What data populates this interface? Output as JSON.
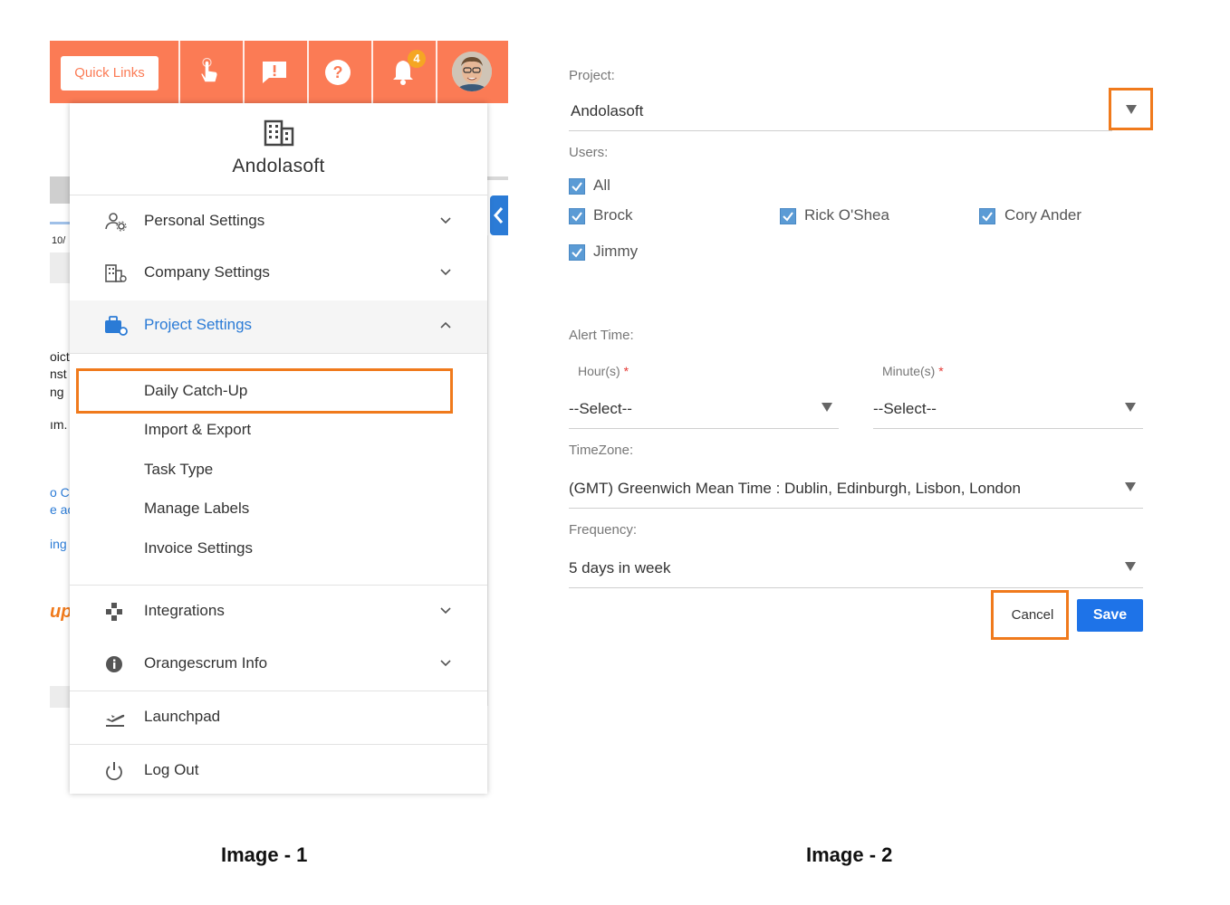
{
  "image1": {
    "topbar": {
      "quick_links_label": "Quick Links",
      "notification_count": "4",
      "icons": [
        "hand-pointer-icon",
        "feedback-icon",
        "help-icon",
        "bell-icon",
        "user-avatar"
      ]
    },
    "background_fragments": [
      "10/",
      "oict",
      "nst",
      "ng",
      "ım.",
      "o C",
      "e ac",
      "ing",
      "up"
    ],
    "menu": {
      "company_name": "Andolasoft",
      "items": [
        {
          "label": "Personal Settings",
          "icon": "user-gear-icon"
        },
        {
          "label": "Company Settings",
          "icon": "building-gear-icon"
        },
        {
          "label": "Project Settings",
          "icon": "briefcase-gear-icon",
          "expanded": true
        }
      ],
      "project_sub_items": [
        "Daily Catch-Up",
        "Import & Export",
        "Task Type",
        "Manage Labels",
        "Invoice Settings"
      ],
      "lower_items": [
        {
          "label": "Integrations",
          "icon": "puzzle-icon"
        },
        {
          "label": "Orangescrum Info",
          "icon": "info-icon"
        },
        {
          "label": "Launchpad",
          "icon": "plane-takeoff-icon"
        },
        {
          "label": "Log Out",
          "icon": "power-icon"
        }
      ]
    },
    "caption": "Image - 1"
  },
  "image2": {
    "project": {
      "label": "Project:",
      "value": "Andolasoft"
    },
    "users": {
      "label": "Users:",
      "options": [
        "All",
        "Brock",
        "Rick O'Shea",
        "Cory Ander",
        "Jimmy"
      ]
    },
    "alert_time": {
      "label": "Alert Time:",
      "hours_label": "Hour(s)",
      "hours_value": "--Select--",
      "minutes_label": "Minute(s)",
      "minutes_value": "--Select--",
      "required_mark": "*"
    },
    "timezone": {
      "label": "TimeZone:",
      "value": "(GMT) Greenwich Mean Time : Dublin, Edinburgh, Lisbon, London"
    },
    "frequency": {
      "label": "Frequency:",
      "value": "5 days in week"
    },
    "buttons": {
      "cancel": "Cancel",
      "save": "Save"
    },
    "caption": "Image - 2"
  },
  "colors": {
    "brand_orange": "#fb7b55",
    "highlight": "#f07a1c",
    "link_blue": "#2b7bd6",
    "save_blue": "#1e73e8"
  }
}
